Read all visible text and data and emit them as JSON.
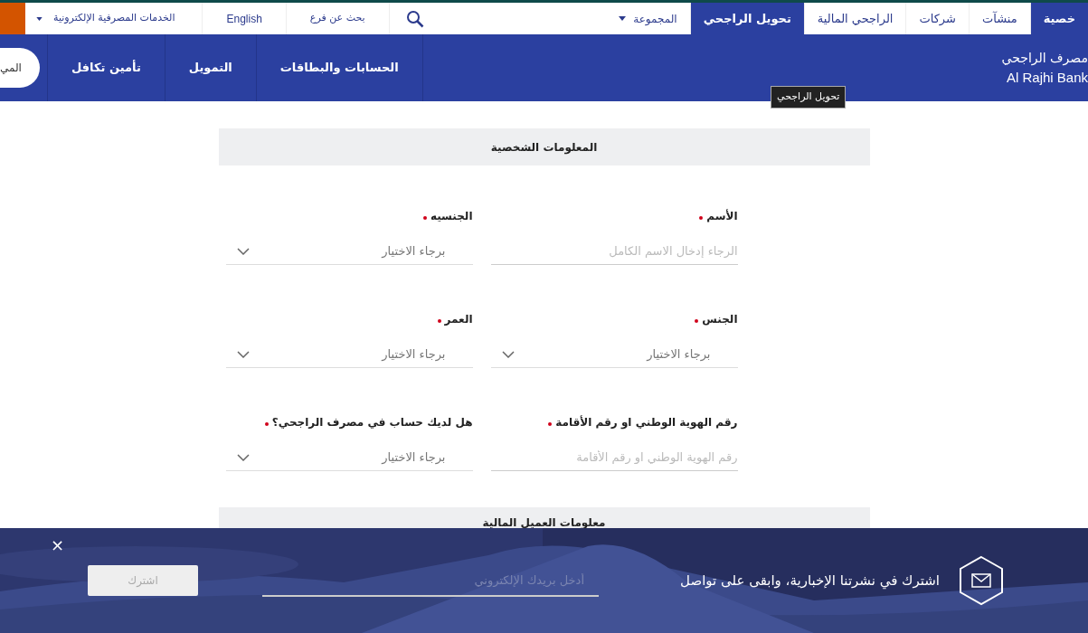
{
  "top_nav": {
    "tabs": [
      {
        "label": "خصية",
        "selected": true
      },
      {
        "label": "منشآت",
        "selected": false
      },
      {
        "label": "شركات",
        "selected": false
      },
      {
        "label": "الراجحي المالية",
        "selected": false
      },
      {
        "label": "تحويل الراجحي",
        "selected": true
      }
    ],
    "group_menu": "المجموعة",
    "branch_link": "بحث عن فرع",
    "language": "English",
    "e_banking": "الخدمات المصرفية الإلكترونية"
  },
  "brand": {
    "name_ar": "مصرف الراجحي",
    "name_en": "Al Rajhi Bank"
  },
  "main_menu": {
    "items": [
      "الحسابات والبطاقات",
      "التمويل",
      "تأمين تكافل"
    ],
    "pill": "المي"
  },
  "tooltip": "تحويل الراجحي",
  "form": {
    "sections": [
      {
        "title": "المعلومات الشخصية",
        "fields": [
          {
            "kind": "text",
            "label": "الأسم",
            "required": true,
            "placeholder": "الرجاء إدخال الاسم الكامل"
          },
          {
            "kind": "select",
            "label": "الجنسيه",
            "required": true,
            "placeholder": "برجاء الاختيار"
          },
          {
            "kind": "select",
            "label": "الجنس",
            "required": true,
            "placeholder": "برجاء الاختيار"
          },
          {
            "kind": "select",
            "label": "العمر",
            "required": true,
            "placeholder": "برجاء الاختيار"
          },
          {
            "kind": "text",
            "label": "رقم الهوية الوطني او رقم الأقامة",
            "required": true,
            "placeholder": "رقم الهوية الوطني او رقم الأقامة"
          },
          {
            "kind": "select",
            "label": "هل لديك حساب في مصرف الراجحي؟",
            "required": true,
            "placeholder": "برجاء الاختيار"
          }
        ]
      },
      {
        "title": "معلومات العميل المالية"
      }
    ]
  },
  "newsletter": {
    "text": "اشترك في نشرتنا الإخبارية، وابقى على تواصل",
    "placeholder": "أدخل بريدك الإلكتروني",
    "button": {
      "label": "اشترك",
      "disabled": true
    },
    "close": "×"
  }
}
